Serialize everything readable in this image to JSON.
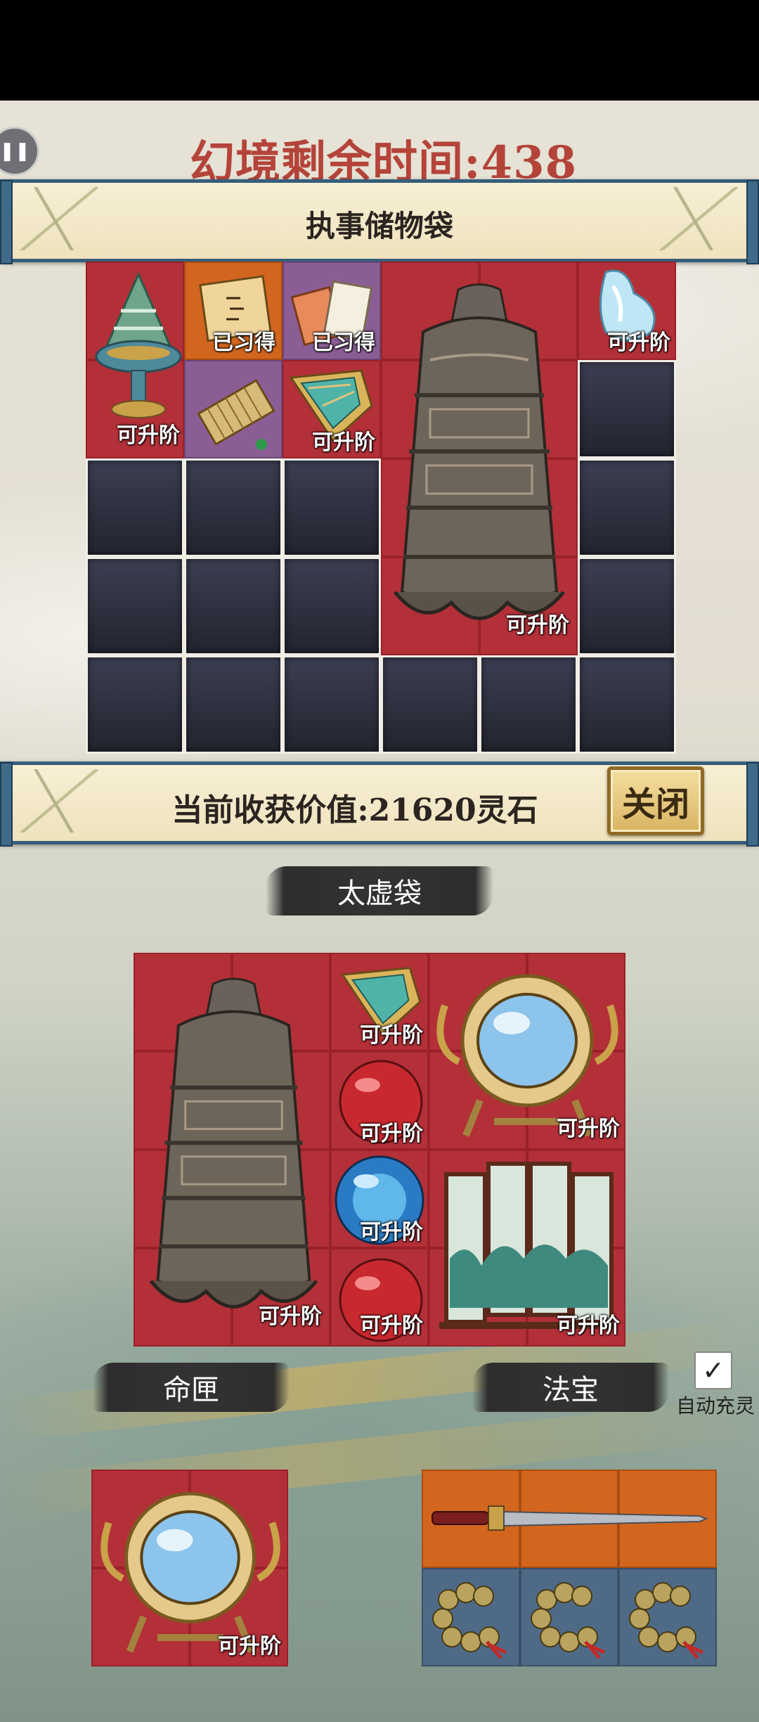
{
  "timer": {
    "text": "幻境剩余时间:438"
  },
  "pause_glyph": "❚❚",
  "top_banner": {
    "title": "执事储物袋"
  },
  "value_banner": {
    "text": "当前收获价值:21620灵石",
    "close_label": "关闭"
  },
  "storage_labels": {
    "incense": "可升阶",
    "recipe1": "已习得",
    "recipe2": "已习得",
    "crystal": "可升阶",
    "leaf": "可升阶",
    "bell": "可升阶"
  },
  "taixu": {
    "title": "太虚袋",
    "labels": {
      "leaf": "可升阶",
      "mirror": "可升阶",
      "ball1": "可升阶",
      "ball2": "可升阶",
      "ball3": "可升阶",
      "screen": "可升阶",
      "bell": "可升阶"
    }
  },
  "minggai": {
    "title": "命匣",
    "mirror_label": "可升阶"
  },
  "fabao": {
    "title": "法宝"
  },
  "auto": {
    "label": "自动充灵",
    "check": "✓",
    "checked": true
  },
  "colors": {
    "red_cell": "#b33038",
    "orange_cell": "#d3661f",
    "purple_cell": "#8a5e95",
    "dark_cell": "#2a2c3a",
    "timer": "#aa281e"
  }
}
